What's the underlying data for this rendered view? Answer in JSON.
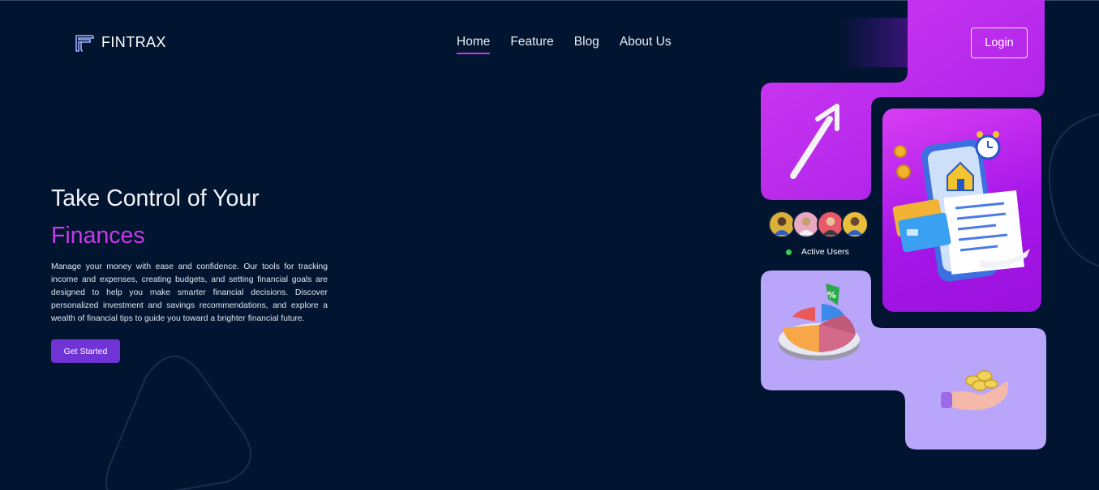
{
  "brand": {
    "name": "FINTRAX",
    "logo_icon": "fintrax-f-logo-icon"
  },
  "nav": {
    "items": [
      {
        "label": "Home",
        "active": true
      },
      {
        "label": "Feature",
        "active": false
      },
      {
        "label": "Blog",
        "active": false
      },
      {
        "label": "About Us",
        "active": false
      }
    ],
    "login_label": "Login"
  },
  "hero": {
    "title_line1": "Take Control of Your",
    "title_line2": "Finances",
    "description": "Manage your money with ease and confidence. Our tools for tracking income and expenses, creating budgets, and setting financial goals are designed to help you make smarter financial decisions. Discover personalized investment and savings recommendations, and explore a wealth of financial tips to guide you toward a brighter financial future.",
    "cta_label": "Get Started"
  },
  "users": {
    "label": "Active Users",
    "status_color": "#3ecf4e"
  },
  "colors": {
    "background": "#011531",
    "accent_magenta": "#c838e8",
    "accent_purple": "#6f33d6",
    "lavender": "#b9a6fb"
  }
}
